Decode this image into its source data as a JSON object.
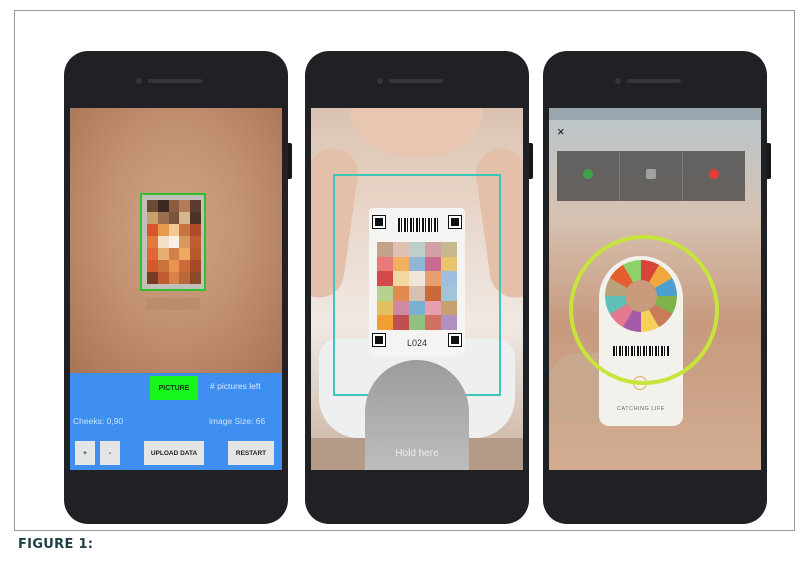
{
  "figure": {
    "caption": "FIGURE 1:"
  },
  "phone1": {
    "status_text": "",
    "picture_button": "PICTURE",
    "pictures_left": "# pictures left",
    "cheeks": "Cheeks: 0,90",
    "image_size": "image Size: 66",
    "plus_button": "+",
    "minus_button": "-",
    "upload_button": "UPLOAD DATA",
    "restart_button": "RESTART"
  },
  "phone2": {
    "card_code": "L024",
    "hold_text": "Hold here"
  },
  "phone3": {
    "close": "×",
    "status_left": "",
    "status_right": "",
    "tools": [
      "",
      "",
      ""
    ],
    "brand": "CATCHING LIFE"
  },
  "colors": {
    "panel_blue": "#3e8ff0",
    "picture_green": "#17f61b",
    "detect_green": "#2fbf2f",
    "teal_box": "#3ec6b8",
    "ring_yellow": "#c7e43a",
    "caption": "#1f3f47"
  },
  "icons": [
    "close-icon",
    "camera-icon",
    "flash-icon",
    "mic-icon"
  ]
}
